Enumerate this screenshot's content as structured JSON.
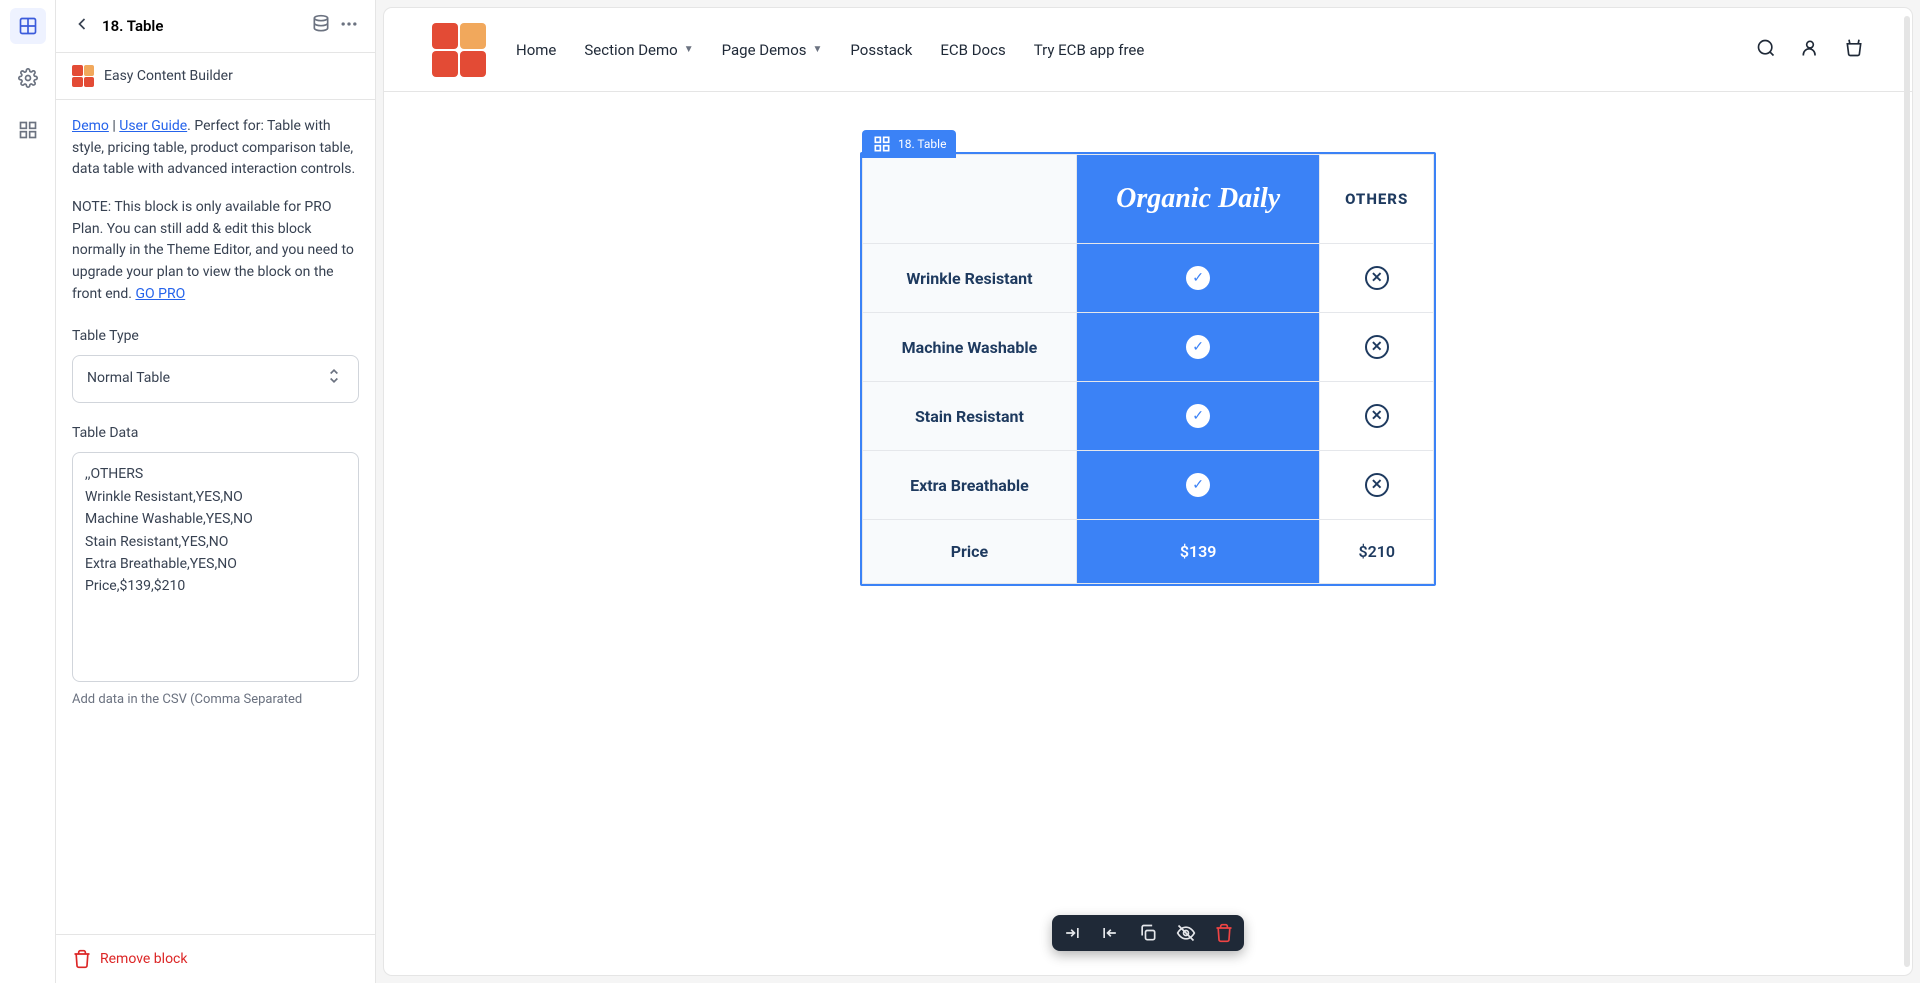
{
  "leftRail": {
    "blocks": "blocks",
    "settings": "settings",
    "apps": "apps"
  },
  "sidebar": {
    "title": "18. Table",
    "brand": "Easy Content Builder",
    "intro_link1": "Demo",
    "intro_sep": " | ",
    "intro_link2": "User Guide",
    "intro_rest": ". Perfect for: Table with style, pricing table, product comparison table, data table with advanced interaction controls.",
    "note": "NOTE: This block is only available for PRO Plan. You can still add & edit this block normally in the Theme Editor, and you need to upgrade your plan to view the block on the front end. ",
    "note_link": "GO PRO",
    "tableTypeLabel": "Table Type",
    "tableTypeValue": "Normal Table",
    "tableDataLabel": "Table Data",
    "tableDataValue": ",,OTHERS\nWrinkle Resistant,YES,NO\nMachine Washable,YES,NO\nStain Resistant,YES,NO\nExtra Breathable,YES,NO\nPrice,$139,$210",
    "helpText": "Add data in the CSV (Comma Separated",
    "removeLabel": "Remove block"
  },
  "topbar": {
    "nav": {
      "home": "Home",
      "sectionDemo": "Section Demo",
      "pageDemos": "Page Demos",
      "posstack": "Posstack",
      "ecbDocs": "ECB Docs",
      "tryFree": "Try ECB app free"
    }
  },
  "tableBlock": {
    "tag": "18. Table",
    "brandName": "Organic Daily",
    "othersHeader": "OTHERS",
    "rows": {
      "r1": "Wrinkle Resistant",
      "r2": "Machine Washable",
      "r3": "Stain Resistant",
      "r4": "Extra Breathable",
      "r5": "Price"
    },
    "price1": "$139",
    "price2": "$210"
  }
}
